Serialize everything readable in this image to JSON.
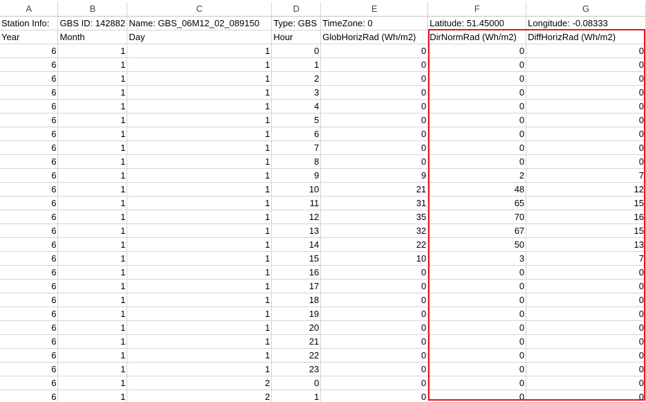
{
  "column_headers": [
    "A",
    "B",
    "C",
    "D",
    "E",
    "F",
    "G"
  ],
  "info_row": [
    "Station Info:",
    "GBS ID: 142882",
    "Name: GBS_06M12_02_089150",
    "Type: GBS",
    "TimeZone: 0",
    "Latitude: 51.45000",
    "Longitude: -0.08333"
  ],
  "field_row": [
    "Year",
    "Month",
    "Day",
    "Hour",
    "GlobHorizRad (Wh/m2)",
    "DirNormRad (Wh/m2)",
    "DiffHorizRad (Wh/m2)"
  ],
  "rows": [
    [
      "6",
      "1",
      "1",
      "0",
      "0",
      "0",
      "0"
    ],
    [
      "6",
      "1",
      "1",
      "1",
      "0",
      "0",
      "0"
    ],
    [
      "6",
      "1",
      "1",
      "2",
      "0",
      "0",
      "0"
    ],
    [
      "6",
      "1",
      "1",
      "3",
      "0",
      "0",
      "0"
    ],
    [
      "6",
      "1",
      "1",
      "4",
      "0",
      "0",
      "0"
    ],
    [
      "6",
      "1",
      "1",
      "5",
      "0",
      "0",
      "0"
    ],
    [
      "6",
      "1",
      "1",
      "6",
      "0",
      "0",
      "0"
    ],
    [
      "6",
      "1",
      "1",
      "7",
      "0",
      "0",
      "0"
    ],
    [
      "6",
      "1",
      "1",
      "8",
      "0",
      "0",
      "0"
    ],
    [
      "6",
      "1",
      "1",
      "9",
      "9",
      "2",
      "7"
    ],
    [
      "6",
      "1",
      "1",
      "10",
      "21",
      "48",
      "12"
    ],
    [
      "6",
      "1",
      "1",
      "11",
      "31",
      "65",
      "15"
    ],
    [
      "6",
      "1",
      "1",
      "12",
      "35",
      "70",
      "16"
    ],
    [
      "6",
      "1",
      "1",
      "13",
      "32",
      "67",
      "15"
    ],
    [
      "6",
      "1",
      "1",
      "14",
      "22",
      "50",
      "13"
    ],
    [
      "6",
      "1",
      "1",
      "15",
      "10",
      "3",
      "7"
    ],
    [
      "6",
      "1",
      "1",
      "16",
      "0",
      "0",
      "0"
    ],
    [
      "6",
      "1",
      "1",
      "17",
      "0",
      "0",
      "0"
    ],
    [
      "6",
      "1",
      "1",
      "18",
      "0",
      "0",
      "0"
    ],
    [
      "6",
      "1",
      "1",
      "19",
      "0",
      "0",
      "0"
    ],
    [
      "6",
      "1",
      "1",
      "20",
      "0",
      "0",
      "0"
    ],
    [
      "6",
      "1",
      "1",
      "21",
      "0",
      "0",
      "0"
    ],
    [
      "6",
      "1",
      "1",
      "22",
      "0",
      "0",
      "0"
    ],
    [
      "6",
      "1",
      "1",
      "23",
      "0",
      "0",
      "0"
    ],
    [
      "6",
      "1",
      "2",
      "0",
      "0",
      "0",
      "0"
    ],
    [
      "6",
      "1",
      "2",
      "1",
      "0",
      "0",
      "0"
    ]
  ],
  "highlight_color": "#e8131b"
}
